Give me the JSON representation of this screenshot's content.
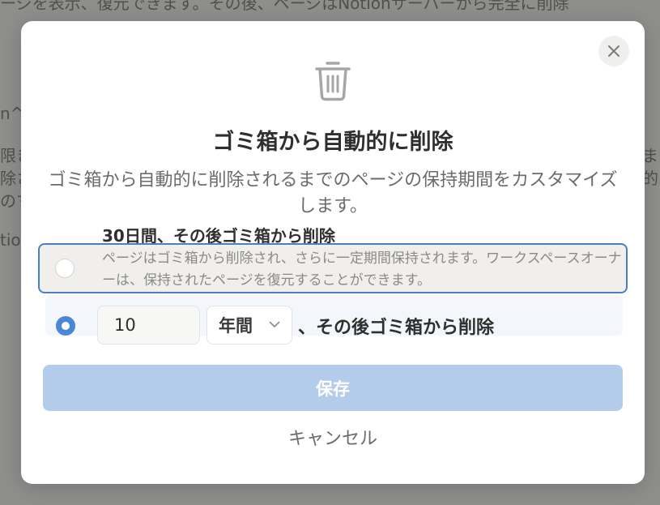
{
  "background": {
    "top_text": "ージを表示、復元できます。その後、ページはNotionサーバーから完全に削除",
    "left_lines": [
      "n^",
      "限き",
      "除さ",
      "のマ",
      "tio"
    ],
    "right_lines": [
      "ま",
      "的"
    ]
  },
  "modal": {
    "close_icon": "close-icon",
    "trash_icon": "trash-icon",
    "title": "ゴミ箱から自動的に削除",
    "subtitle": "ゴミ箱から自動的に削除されるまでのページの保持期間をカスタマイズします。",
    "options": [
      {
        "title": "30日間、その後ゴミ箱から削除",
        "description": "ページはゴミ箱から削除され、さらに一定期間保持されます。ワークスペースオーナーは、保持されたページを復元することができます。",
        "selected": false
      },
      {
        "value": "10",
        "unit": "年間",
        "suffix": "、その後ゴミ箱から削除",
        "selected": true
      }
    ],
    "save_label": "保存",
    "cancel_label": "キャンセル"
  },
  "colors": {
    "accent": "#4a87d4",
    "save_disabled": "#b3cceb",
    "focus_border": "#4a7fc1"
  }
}
